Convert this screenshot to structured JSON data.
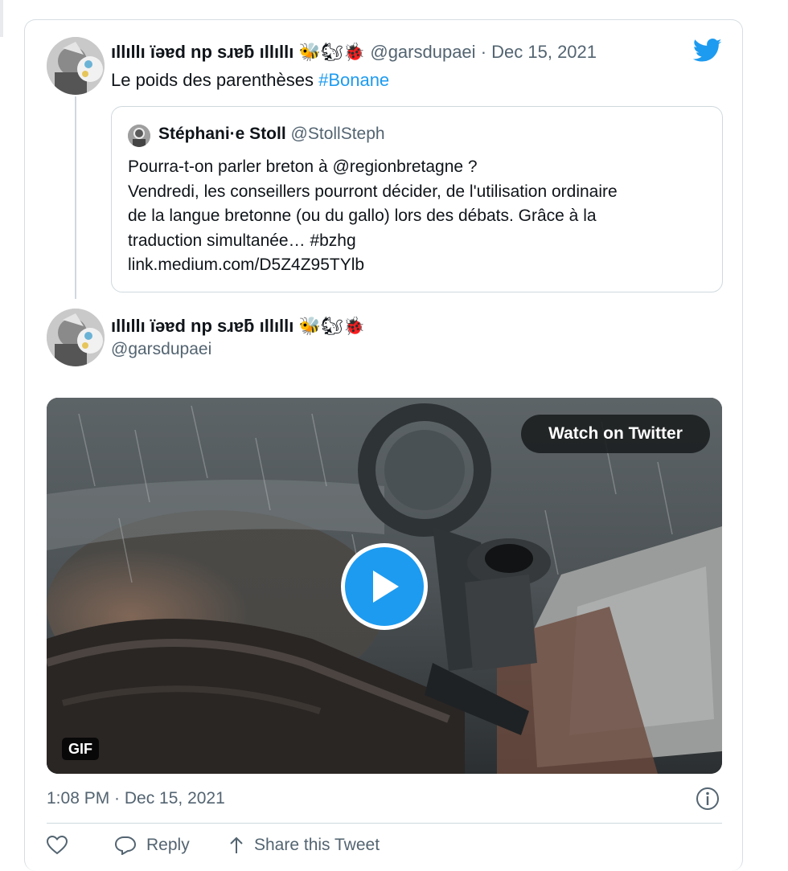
{
  "main_tweet": {
    "display_name": "ıllıllı ïəɐd np sɹɐƃ ıllıllı",
    "emoji": "🐝🐿🐞",
    "handle": "@garsdupaei",
    "separator": "·",
    "date": "Dec 15, 2021",
    "text": "Le poids des parenthèses ",
    "hashtag": "#Bonane"
  },
  "quoted_tweet": {
    "display_name": "Stéphani·e Stoll",
    "handle": "@StollSteph",
    "lines": [
      "Pourra-t-on parler breton à @regionbretagne ?",
      "Vendredi, les conseillers pourront décider, de l'utilisation ordinaire",
      "de la langue bretonne (ou du gallo) lors des débats. Grâce à la",
      "traduction simultanée… #bzhg",
      "link.medium.com/D5Z4Z95TYlb"
    ]
  },
  "reply": {
    "display_name": "ıllıllı ïəɐd np sɹɐƃ ıllıllı",
    "emoji": "🐝🐿🐞",
    "handle": "@garsdupaei"
  },
  "media": {
    "watch_label": "Watch on Twitter",
    "badge": "GIF"
  },
  "footer": {
    "timestamp": "1:08 PM · Dec 15, 2021",
    "reply_label": "Reply",
    "share_label": "Share this Tweet"
  },
  "colors": {
    "accent": "#1d9bf0",
    "muted_text": "#536471",
    "border": "#cfd9de"
  },
  "icons": [
    "twitter-bird-icon",
    "play-icon",
    "info-icon",
    "heart-icon",
    "reply-icon",
    "share-icon"
  ]
}
